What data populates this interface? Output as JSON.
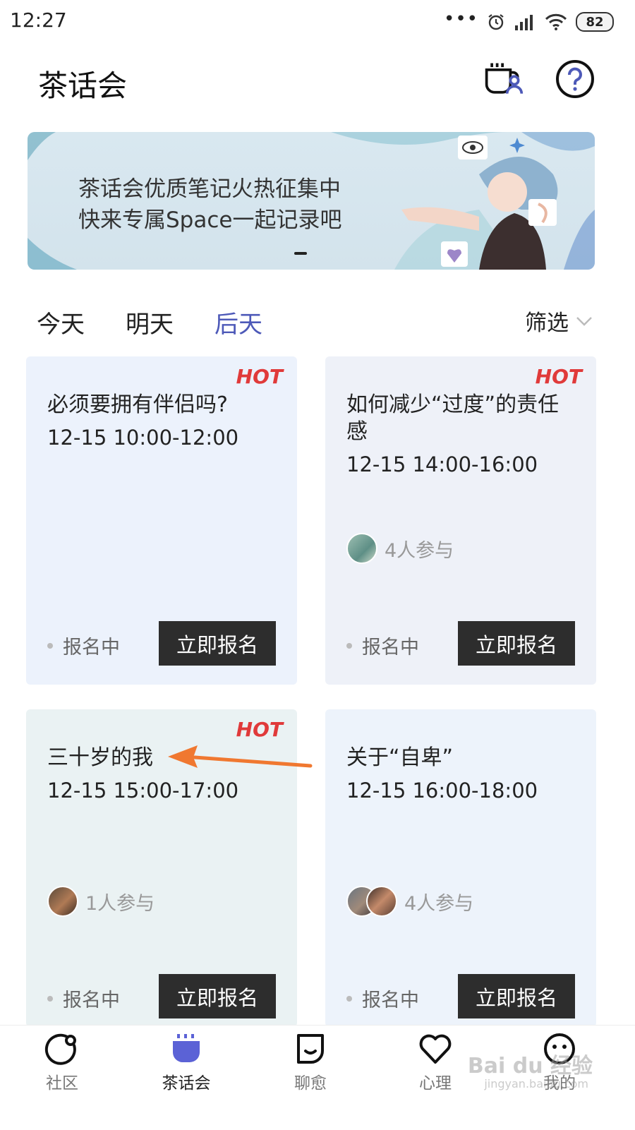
{
  "status_bar": {
    "time": "12:27",
    "dots": "•••",
    "battery": "82"
  },
  "header": {
    "title": "茶话会"
  },
  "banner": {
    "line1": "茶话会优质笔记火热征集中",
    "line2": "快来专属Space一起记录吧"
  },
  "tabs": [
    {
      "label": "今天",
      "active": false
    },
    {
      "label": "明天",
      "active": false
    },
    {
      "label": "后天",
      "active": true
    }
  ],
  "filter_label": "筛选",
  "cards": [
    {
      "hot": "HOT",
      "title": "必须要拥有伴侣吗?",
      "time": "12-15 10:00-12:00",
      "participants": "",
      "status": "报名中",
      "button": "立即报名"
    },
    {
      "hot": "HOT",
      "title": "如何减少“过度”的责任感",
      "time": "12-15 14:00-16:00",
      "participants": "4人参与",
      "status": "报名中",
      "button": "立即报名"
    },
    {
      "hot": "HOT",
      "title": "三十岁的我",
      "time": "12-15 15:00-17:00",
      "participants": "1人参与",
      "status": "报名中",
      "button": "立即报名"
    },
    {
      "hot": "",
      "title": "关于“自卑”",
      "time": "12-15 16:00-18:00",
      "participants": "4人参与",
      "status": "报名中",
      "button": "立即报名"
    }
  ],
  "bottom_nav": [
    {
      "label": "社区",
      "icon": "community-icon",
      "active": false
    },
    {
      "label": "茶话会",
      "icon": "tea-party-icon",
      "active": true
    },
    {
      "label": "聊愈",
      "icon": "chat-heal-icon",
      "active": false
    },
    {
      "label": "心理",
      "icon": "heart-icon",
      "active": false
    },
    {
      "label": "我的",
      "icon": "profile-icon",
      "active": false
    }
  ],
  "watermark": {
    "main": "Bai du 经验",
    "sub": "jingyan.baidu.com"
  },
  "colors": {
    "accent": "#4d59b8",
    "hot": "#e03a3a",
    "button_bg": "#2d2d2d",
    "arrow": "#f07830"
  }
}
